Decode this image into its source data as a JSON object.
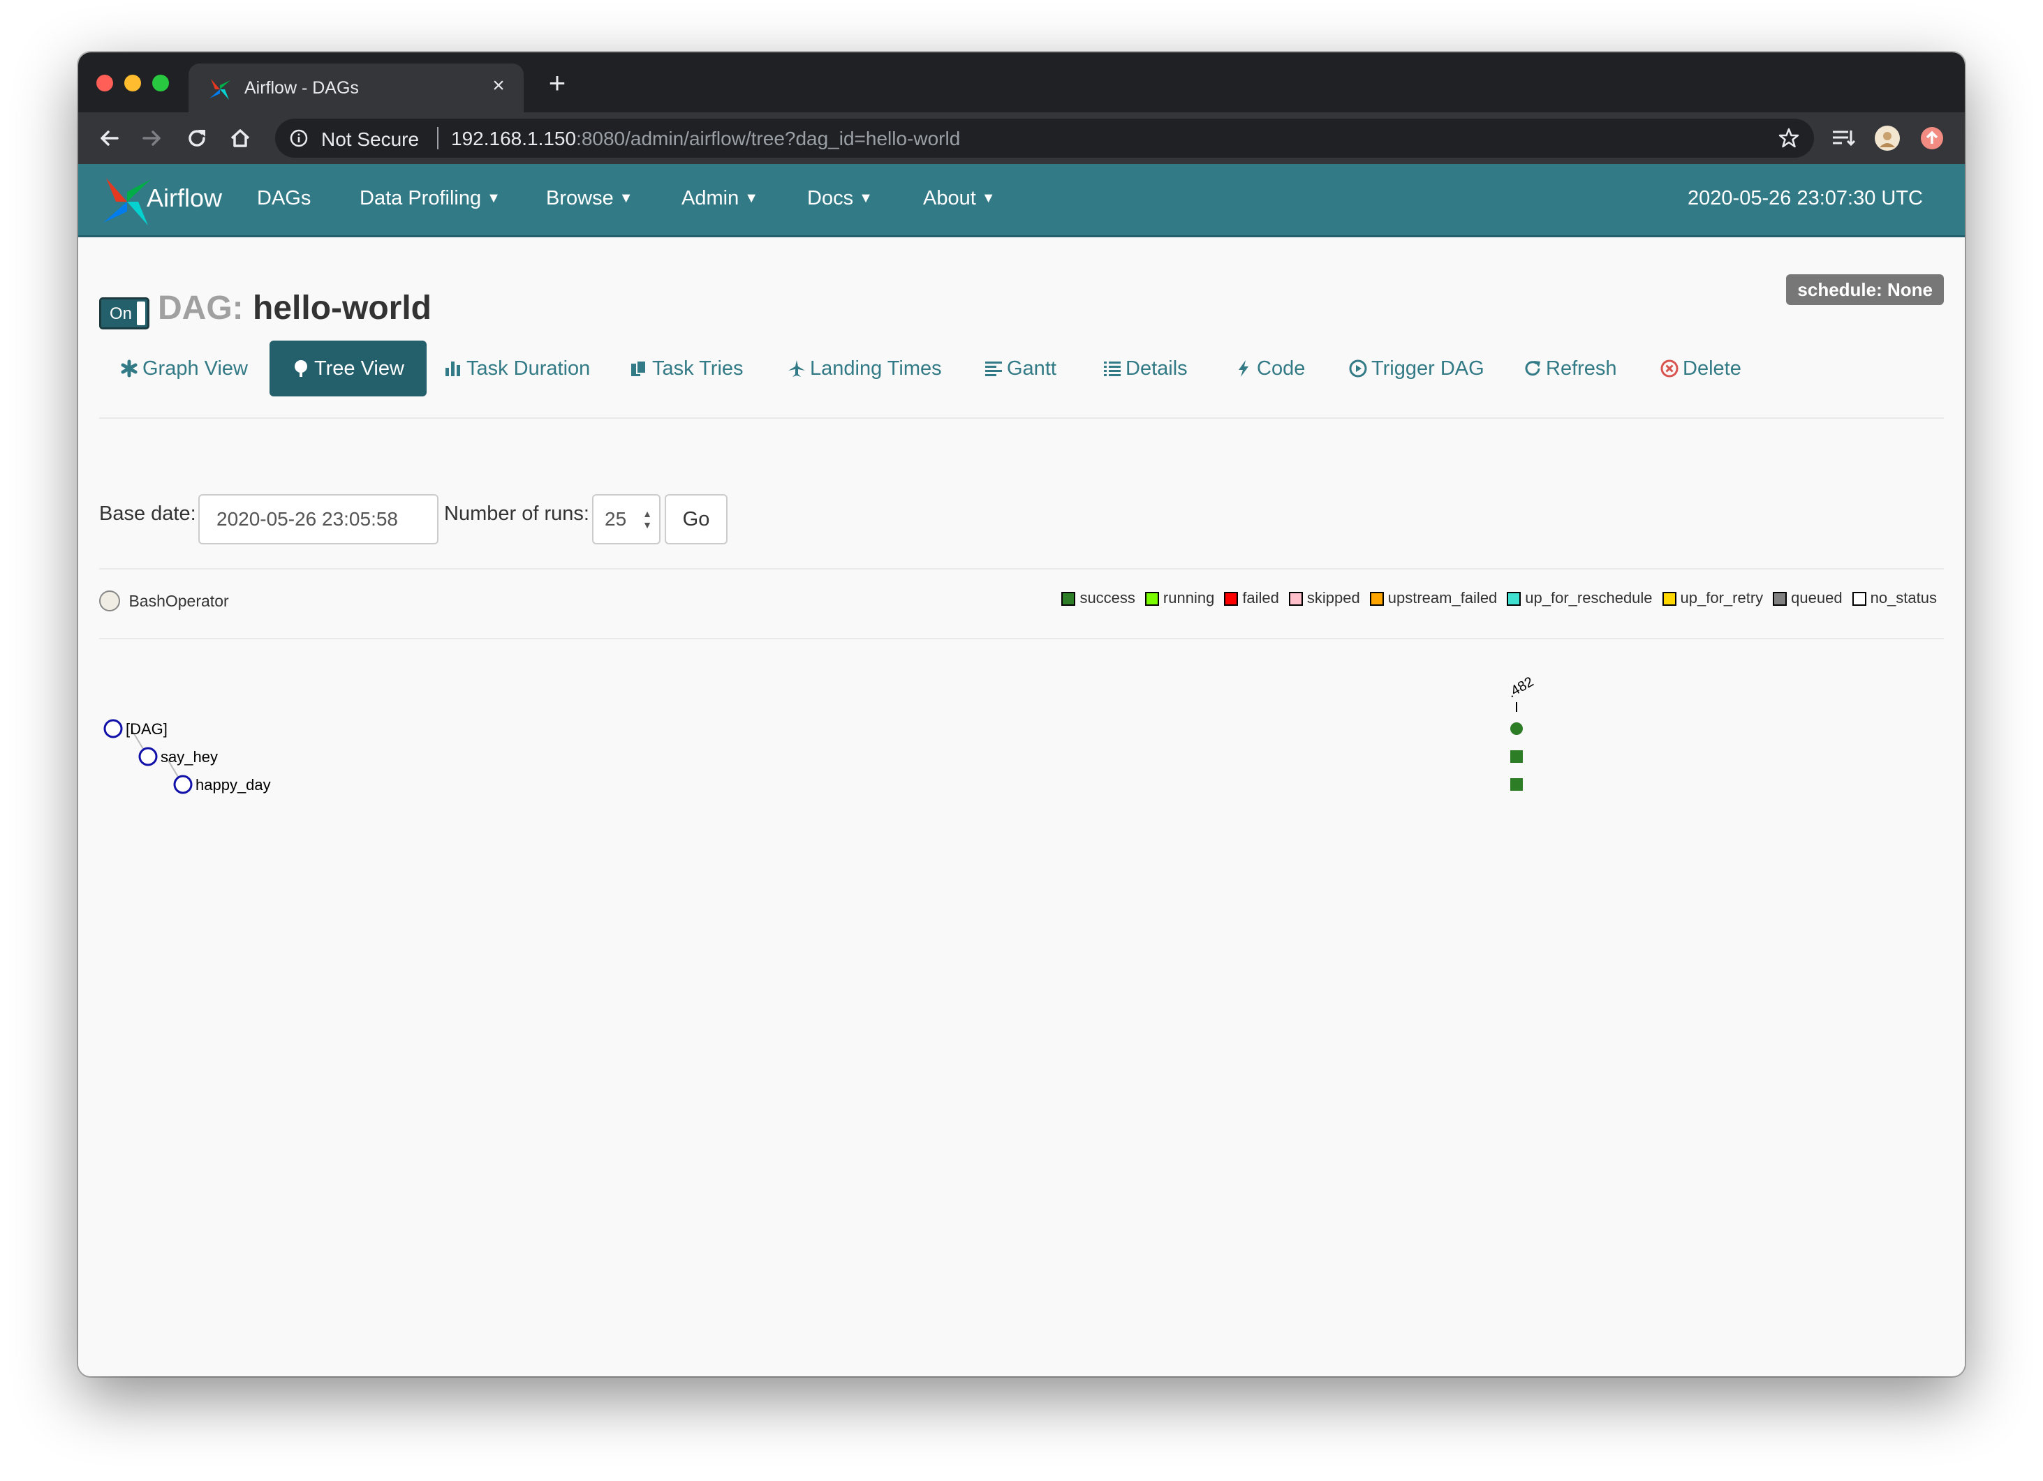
{
  "browser": {
    "tab_title": "Airflow - DAGs",
    "security_label": "Not Secure",
    "url_host": "192.168.1.150",
    "url_path": ":8080/admin/airflow/tree?dag_id=hello-world"
  },
  "navbar": {
    "brand": "Airflow",
    "items": [
      {
        "label": "DAGs",
        "dropdown": false
      },
      {
        "label": "Data Profiling",
        "dropdown": true
      },
      {
        "label": "Browse",
        "dropdown": true
      },
      {
        "label": "Admin",
        "dropdown": true
      },
      {
        "label": "Docs",
        "dropdown": true
      },
      {
        "label": "About",
        "dropdown": true
      }
    ],
    "clock": "2020-05-26 23:07:30 UTC"
  },
  "dag": {
    "toggle_label": "On",
    "title_prefix": "DAG:",
    "title": "hello-world",
    "schedule": "schedule: None"
  },
  "view_tabs": [
    {
      "label": "Graph View",
      "icon": "asterisk-icon",
      "active": false
    },
    {
      "label": "Tree View",
      "icon": "tree-icon",
      "active": true
    },
    {
      "label": "Task Duration",
      "icon": "bar-chart-icon",
      "active": false
    },
    {
      "label": "Task Tries",
      "icon": "duplicate-icon",
      "active": false
    },
    {
      "label": "Landing Times",
      "icon": "plane-icon",
      "active": false
    },
    {
      "label": "Gantt",
      "icon": "align-left-icon",
      "active": false
    },
    {
      "label": "Details",
      "icon": "list-icon",
      "active": false
    },
    {
      "label": "Code",
      "icon": "flash-icon",
      "active": false
    },
    {
      "label": "Trigger DAG",
      "icon": "play-circle-icon",
      "active": false
    },
    {
      "label": "Refresh",
      "icon": "refresh-icon",
      "active": false
    },
    {
      "label": "Delete",
      "icon": "remove-circle-icon",
      "active": false
    }
  ],
  "form": {
    "base_date_label": "Base date:",
    "base_date_value": "2020-05-26 23:05:58",
    "runs_label": "Number of runs:",
    "runs_value": "25",
    "go_label": "Go"
  },
  "operator_legend": {
    "label": "BashOperator",
    "color": "#f0ede4"
  },
  "state_legend": [
    {
      "label": "success",
      "color": "#2d7d27"
    },
    {
      "label": "running",
      "color": "#7cfc00"
    },
    {
      "label": "failed",
      "color": "#ff0000"
    },
    {
      "label": "skipped",
      "color": "#ffc0cb"
    },
    {
      "label": "upstream_failed",
      "color": "#ffa500"
    },
    {
      "label": "up_for_reschedule",
      "color": "#40e0d0"
    },
    {
      "label": "up_for_retry",
      "color": "#ffd700"
    },
    {
      "label": "queued",
      "color": "#808080"
    },
    {
      "label": "no_status",
      "color": "#ffffff"
    }
  ],
  "tree": {
    "nodes": [
      "[DAG]",
      "say_hey",
      "happy_day"
    ],
    "run_label": ".482",
    "run_state_color": "#2d7d27"
  }
}
